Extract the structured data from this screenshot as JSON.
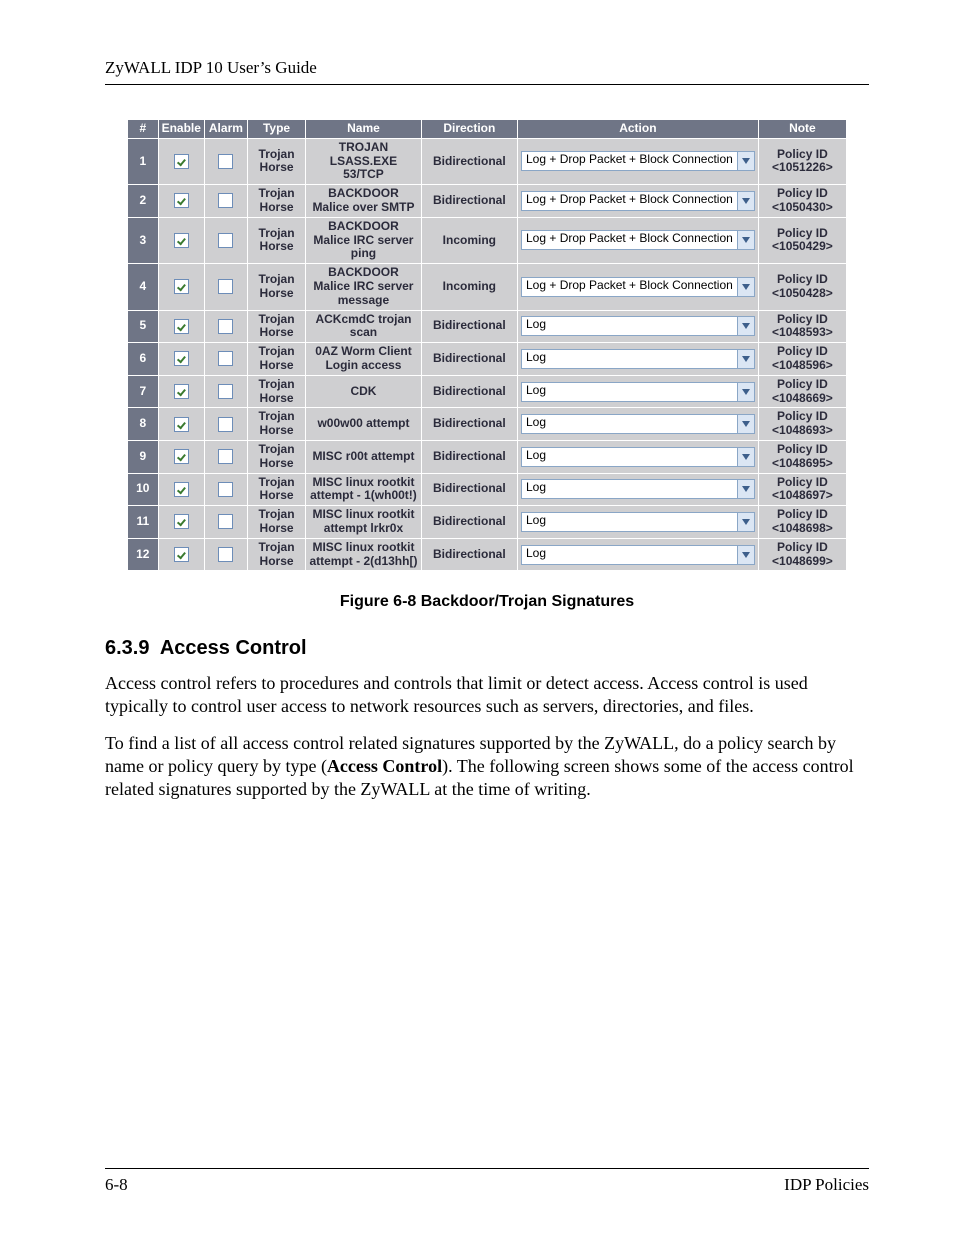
{
  "header": {
    "running": "ZyWALL IDP 10 User’s Guide"
  },
  "table": {
    "headers": {
      "num": "#",
      "enable": "Enable",
      "alarm": "Alarm",
      "type": "Type",
      "name": "Name",
      "direction": "Direction",
      "action": "Action",
      "note": "Note"
    },
    "rows": [
      {
        "num": "1",
        "enable": true,
        "alarm": false,
        "type": "Trojan Horse",
        "name": "TROJAN LSASS.EXE 53/TCP",
        "direction": "Bidirectional",
        "action": "Log + Drop Packet + Block Connection",
        "note": "Policy ID <1051226>"
      },
      {
        "num": "2",
        "enable": true,
        "alarm": false,
        "type": "Trojan Horse",
        "name": "BACKDOOR Malice over SMTP",
        "direction": "Bidirectional",
        "action": "Log + Drop Packet + Block Connection",
        "note": "Policy ID <1050430>"
      },
      {
        "num": "3",
        "enable": true,
        "alarm": false,
        "type": "Trojan Horse",
        "name": "BACKDOOR Malice IRC server ping",
        "direction": "Incoming",
        "action": "Log + Drop Packet + Block Connection",
        "note": "Policy ID <1050429>"
      },
      {
        "num": "4",
        "enable": true,
        "alarm": false,
        "type": "Trojan Horse",
        "name": "BACKDOOR Malice IRC server message",
        "direction": "Incoming",
        "action": "Log + Drop Packet + Block Connection",
        "note": "Policy ID <1050428>"
      },
      {
        "num": "5",
        "enable": true,
        "alarm": false,
        "type": "Trojan Horse",
        "name": "ACKcmdC trojan scan",
        "direction": "Bidirectional",
        "action": "Log",
        "note": "Policy ID <1048593>"
      },
      {
        "num": "6",
        "enable": true,
        "alarm": false,
        "type": "Trojan Horse",
        "name": "0AZ Worm Client Login access",
        "direction": "Bidirectional",
        "action": "Log",
        "note": "Policy ID <1048596>"
      },
      {
        "num": "7",
        "enable": true,
        "alarm": false,
        "type": "Trojan Horse",
        "name": "CDK",
        "direction": "Bidirectional",
        "action": "Log",
        "note": "Policy ID <1048669>"
      },
      {
        "num": "8",
        "enable": true,
        "alarm": false,
        "type": "Trojan Horse",
        "name": "w00w00 attempt",
        "direction": "Bidirectional",
        "action": "Log",
        "note": "Policy ID <1048693>"
      },
      {
        "num": "9",
        "enable": true,
        "alarm": false,
        "type": "Trojan Horse",
        "name": "MISC r00t attempt",
        "direction": "Bidirectional",
        "action": "Log",
        "note": "Policy ID <1048695>"
      },
      {
        "num": "10",
        "enable": true,
        "alarm": false,
        "type": "Trojan Horse",
        "name": "MISC linux rootkit attempt - 1(wh00t!)",
        "direction": "Bidirectional",
        "action": "Log",
        "note": "Policy ID <1048697>"
      },
      {
        "num": "11",
        "enable": true,
        "alarm": false,
        "type": "Trojan Horse",
        "name": "MISC linux rootkit attempt lrkr0x",
        "direction": "Bidirectional",
        "action": "Log",
        "note": "Policy ID <1048698>"
      },
      {
        "num": "12",
        "enable": true,
        "alarm": false,
        "type": "Trojan Horse",
        "name": "MISC linux rootkit attempt - 2(d13hh[)",
        "direction": "Bidirectional",
        "action": "Log",
        "note": "Policy ID <1048699>"
      }
    ]
  },
  "caption": "Figure 6-8 Backdoor/Trojan Signatures",
  "section": {
    "num": "6.3.9",
    "title": "Access Control",
    "p1": "Access control refers to procedures and controls that limit or detect access. Access control is used typically to control user access to network resources such as servers, directories, and files.",
    "p2a": "To find a list of all access control related signatures supported by the ZyWALL, do a policy search by name or policy query by type (",
    "p2b": "Access Control",
    "p2c": "). The following screen shows some of the access control related signatures supported by the ZyWALL at the time of writing."
  },
  "footer": {
    "left": "6-8",
    "right": "IDP Policies"
  }
}
